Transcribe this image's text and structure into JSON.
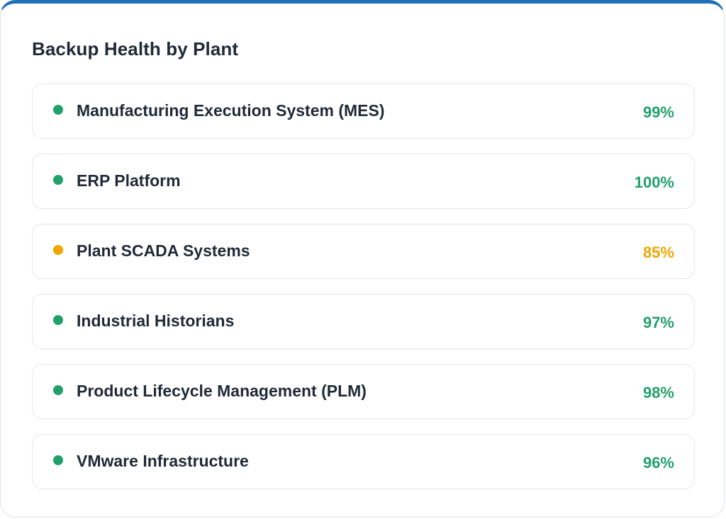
{
  "card": {
    "title": "Backup Health by Plant"
  },
  "colors": {
    "accent_top": "#1f6fb8",
    "healthy": "#22a06b",
    "warning": "#f0a500"
  },
  "items": [
    {
      "label": "Manufacturing Execution System (MES)",
      "value": "99%",
      "status": "healthy"
    },
    {
      "label": "ERP Platform",
      "value": "100%",
      "status": "healthy"
    },
    {
      "label": "Plant SCADA Systems",
      "value": "85%",
      "status": "warning"
    },
    {
      "label": "Industrial Historians",
      "value": "97%",
      "status": "healthy"
    },
    {
      "label": "Product Lifecycle Management (PLM)",
      "value": "98%",
      "status": "healthy"
    },
    {
      "label": "VMware Infrastructure",
      "value": "96%",
      "status": "healthy"
    }
  ]
}
